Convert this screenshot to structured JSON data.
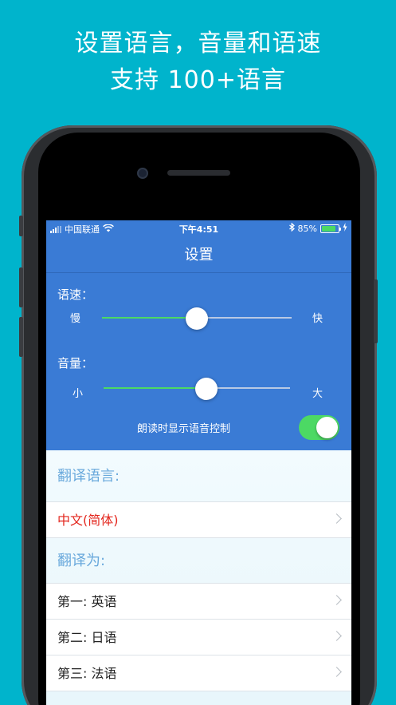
{
  "headline": {
    "line1": "设置语言，音量和语速",
    "line2": "支持 100+语言"
  },
  "status_bar": {
    "carrier": "中国联通",
    "time": "下午4:51",
    "battery": "85%",
    "battery_level": 0.85
  },
  "navbar": {
    "title": "设置"
  },
  "speed": {
    "label": "语速：",
    "min_label": "慢",
    "max_label": "快",
    "value": 0.5
  },
  "volume": {
    "label": "音量：",
    "min_label": "小",
    "max_label": "大",
    "value": 0.55
  },
  "voice_control": {
    "label": "朗读时显示语音控制",
    "on": true
  },
  "source_section": {
    "title": "翻译语言:",
    "language": "中文(简体)"
  },
  "target_section": {
    "title": "翻译为:",
    "items": [
      "第一: 英语",
      "第二: 日语",
      "第三: 法语"
    ]
  },
  "colors": {
    "background": "#00b4cc",
    "panel": "#3a7bd5",
    "accent_green": "#4cd964",
    "source_language": "#e3261d",
    "section_title": "#6aa9dc"
  }
}
